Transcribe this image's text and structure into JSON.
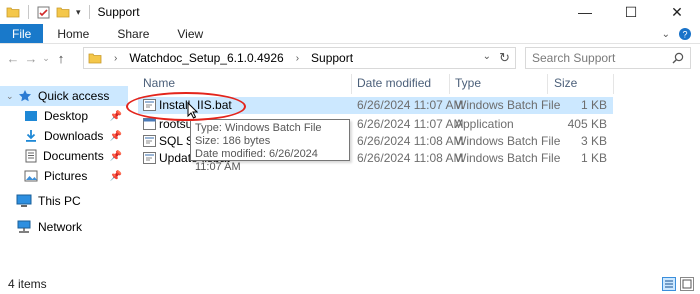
{
  "window": {
    "title": "Support",
    "controls": {
      "minimize": "—",
      "maximize": "☐",
      "close": "✕"
    }
  },
  "ribbon": {
    "tabs": [
      "File",
      "Home",
      "Share",
      "View"
    ]
  },
  "address": {
    "breadcrumb": [
      "Watchdoc_Setup_6.1.0.4926",
      "Support"
    ],
    "search_placeholder": "Search Support"
  },
  "nav_pane": {
    "quick_access": "Quick access",
    "items": [
      {
        "label": "Desktop",
        "pinned": true
      },
      {
        "label": "Downloads",
        "pinned": true
      },
      {
        "label": "Documents",
        "pinned": true
      },
      {
        "label": "Pictures",
        "pinned": true
      }
    ],
    "this_pc": "This PC",
    "network": "Network"
  },
  "columns": {
    "name": "Name",
    "date": "Date modified",
    "type": "Type",
    "size": "Size"
  },
  "files": [
    {
      "name": "Install_IIS.bat",
      "date": "6/26/2024 11:07 AM",
      "type": "Windows Batch File",
      "size": "1 KB",
      "selected": true
    },
    {
      "name": "rootsu",
      "date": "6/26/2024 11:07 AM",
      "type": "Application",
      "size": "405 KB",
      "selected": false
    },
    {
      "name": "SQL Se",
      "date": "6/26/2024 11:08 AM",
      "type": "Windows Batch File",
      "size": "3 KB",
      "selected": false
    },
    {
      "name": "Update-iisbat",
      "date": "6/26/2024 11:08 AM",
      "type": "Windows Batch File",
      "size": "1 KB",
      "selected": false
    }
  ],
  "tooltip": {
    "type": "Type: Windows Batch File",
    "size": "Size: 186 bytes",
    "date": "Date modified: 6/26/2024 11:07 AM"
  },
  "status": {
    "items_count": "4 items"
  },
  "colors": {
    "accent": "#1979ca",
    "selection": "#cce8ff",
    "annotation": "#e3241b"
  }
}
